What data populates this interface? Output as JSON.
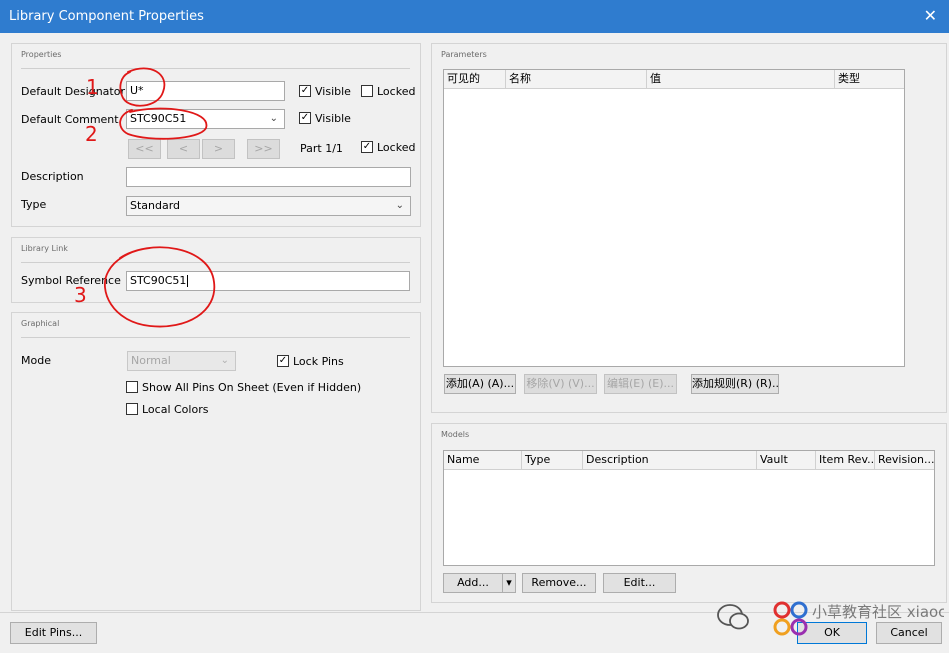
{
  "window": {
    "title": "Library Component Properties",
    "close": "✕"
  },
  "properties": {
    "section_title": "Properties",
    "designator_label": "Default Designator",
    "designator_value": "U*",
    "comment_label": "Default Comment",
    "comment_value": "STC90C51",
    "visible_label": "Visible",
    "locked_label": "Locked",
    "nav_buttons": [
      "<<",
      "<",
      ">",
      ">>"
    ],
    "part_label": "Part 1/1",
    "description_label": "Description",
    "description_value": "",
    "type_label": "Type",
    "type_value": "Standard"
  },
  "library_link": {
    "section_title": "Library Link",
    "symbol_ref_label": "Symbol Reference",
    "symbol_ref_value": "STC90C51"
  },
  "graphical": {
    "section_title": "Graphical",
    "mode_label": "Mode",
    "mode_value": "Normal",
    "lock_pins_label": "Lock Pins",
    "show_all_pins_label": "Show All Pins On Sheet (Even if Hidden)",
    "local_colors_label": "Local Colors"
  },
  "parameters": {
    "section_title": "Parameters",
    "columns": [
      "可见的",
      "名称",
      "值",
      "类型"
    ],
    "buttons": [
      "添加(A) (A)...",
      "移除(V) (V)...",
      "编辑(E) (E)...",
      "添加规则(R) (R)..."
    ]
  },
  "models": {
    "section_title": "Models",
    "columns": [
      "Name",
      "Type",
      "Description",
      "Vault",
      "Item Rev...",
      "Revision..."
    ],
    "buttons": [
      "Add...",
      "▾",
      "Remove...",
      "Edit..."
    ]
  },
  "footer": {
    "edit_pins": "Edit Pins...",
    "ok": "OK",
    "cancel": "Cancel",
    "watermark": "小草教育社区 xiaocaobao.com"
  },
  "colors": {
    "titlebar": "#2f7ccf",
    "annotation": "#e01818"
  },
  "annotations": [
    "1",
    "2",
    "3"
  ]
}
